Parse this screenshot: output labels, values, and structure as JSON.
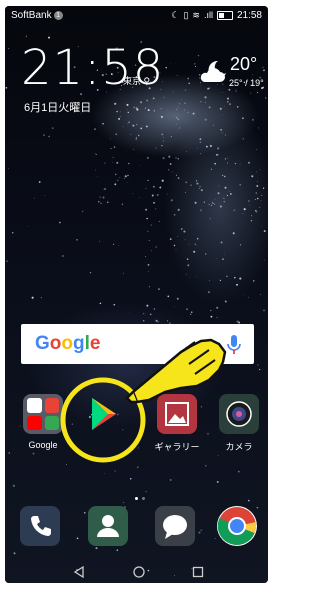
{
  "statusbar": {
    "carrier": "SoftBank",
    "carrier_badge": "1",
    "time": "21:58"
  },
  "lockclock": {
    "time": "21:58",
    "city": "東京",
    "date": "6月1日火曜日"
  },
  "weather": {
    "icon": "partly-cloudy-night-icon",
    "temperature": "20°",
    "range": "25° / 19°"
  },
  "search": {
    "logo": "Google",
    "logo_colors": [
      "#4285F4",
      "#EA4335",
      "#FBBC05",
      "#4285F4",
      "#34A853",
      "#EA4335"
    ]
  },
  "apps": [
    {
      "label": "Google",
      "icon": "google-folder-icon"
    },
    {
      "label": "",
      "icon": "play-store-icon"
    },
    {
      "label": "ギャラリー",
      "icon": "gallery-icon"
    },
    {
      "label": "カメラ",
      "icon": "camera-icon"
    }
  ],
  "dock": [
    {
      "icon": "phone-icon"
    },
    {
      "icon": "contacts-icon"
    },
    {
      "icon": "messages-icon"
    },
    {
      "icon": "chrome-icon"
    }
  ],
  "annotation": {
    "highlight_color": "#f5e51a"
  },
  "colors": {
    "accent_blue": "#4285F4",
    "highlight": "#f5e51a"
  }
}
